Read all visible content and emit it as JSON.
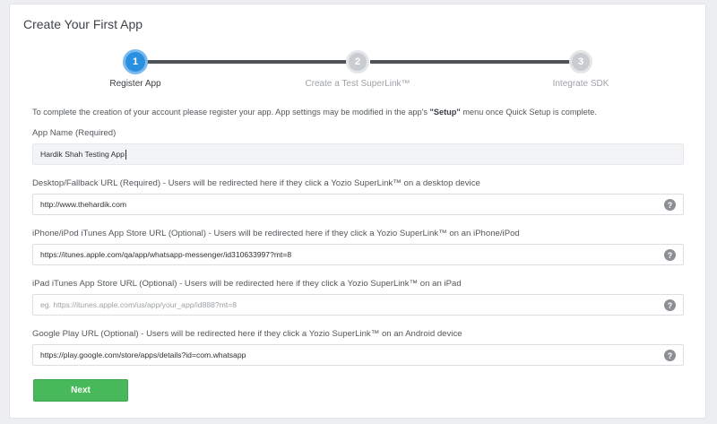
{
  "page_title": "Create Your First App",
  "steps": [
    {
      "number": "1",
      "label": "Register App",
      "state": "active"
    },
    {
      "number": "2",
      "label": "Create a Test SuperLink™",
      "state": "inactive"
    },
    {
      "number": "3",
      "label": "Integrate SDK",
      "state": "inactive"
    }
  ],
  "intro": {
    "before": "To complete the creation of your account please register your app. App settings may be modified in the app's ",
    "bold": "\"Setup\"",
    "after": " menu once Quick Setup is complete."
  },
  "fields": {
    "app_name": {
      "label": "App Name (Required)",
      "value": "Hardik Shah Testing App"
    },
    "desktop_url": {
      "label": "Desktop/Fallback URL (Required) - Users will be redirected here if they click a Yozio SuperLink™ on a desktop device",
      "value": "http://www.thehardik.com"
    },
    "iphone_url": {
      "label": "iPhone/iPod iTunes App Store URL (Optional) - Users will be redirected here if they click a Yozio SuperLink™ on an iPhone/iPod",
      "value": "https://itunes.apple.com/qa/app/whatsapp-messenger/id310633997?mt=8"
    },
    "ipad_url": {
      "label": "iPad iTunes App Store URL (Optional) - Users will be redirected here if they click a Yozio SuperLink™ on an iPad",
      "placeholder": "eg. https://itunes.apple.com/us/app/your_app/id888?mt=8"
    },
    "google_play_url": {
      "label": "Google Play URL (Optional) - Users will be redirected here if they click a Yozio SuperLink™ on an Android device",
      "value": "https://play.google.com/store/apps/details?id=com.whatsapp"
    }
  },
  "help_glyph": "?",
  "next_label": "Next",
  "colors": {
    "accent_blue": "#2b8fe0",
    "button_green": "#48b95a",
    "step_line": "#4e5357"
  }
}
